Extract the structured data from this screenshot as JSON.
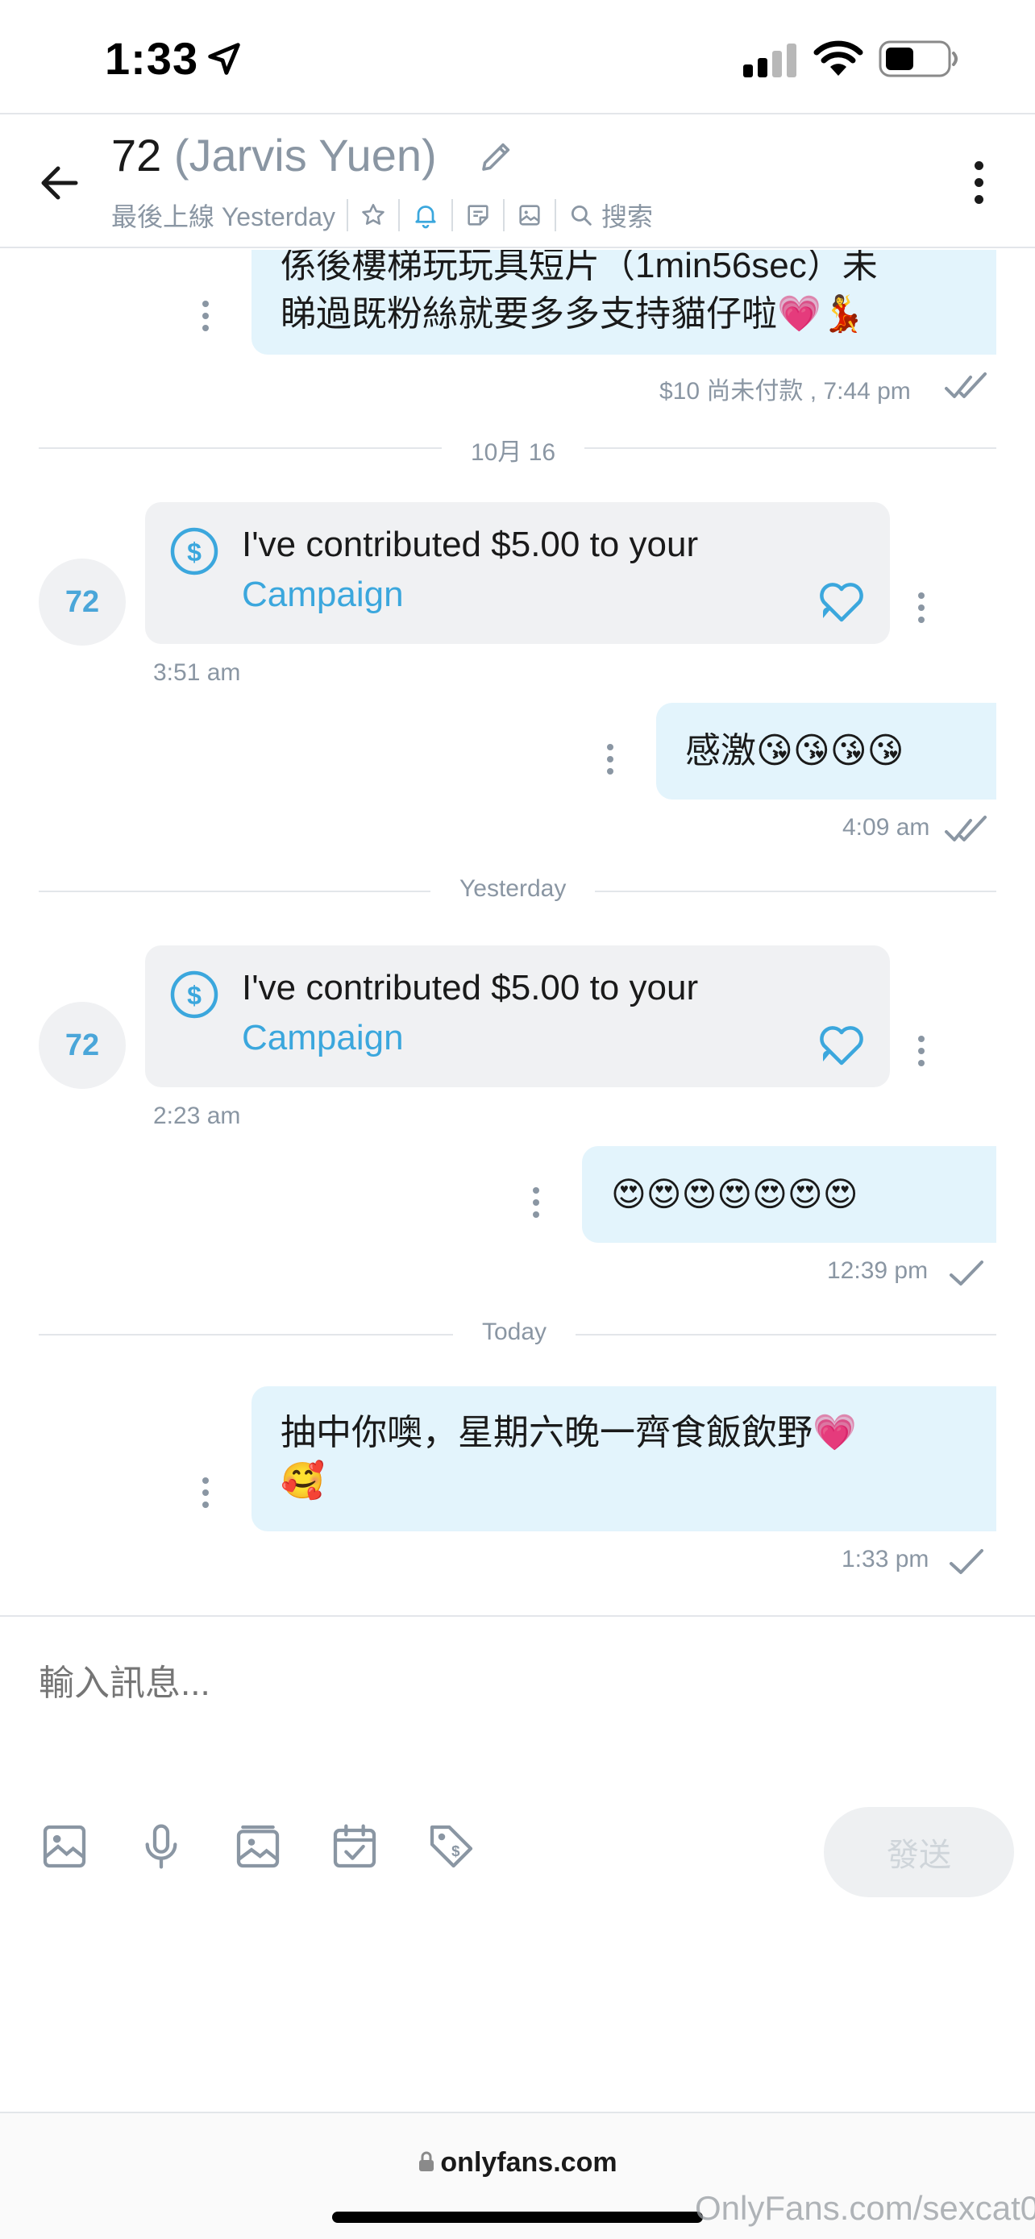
{
  "status_bar": {
    "time": "1:33",
    "icons": [
      "location-arrow-icon",
      "signal-icon",
      "wifi-icon",
      "battery-icon"
    ]
  },
  "header": {
    "title_name": "72",
    "title_username": "(Jarvis Yuen)",
    "last_seen": "最後上線 Yesterday",
    "search_label": "搜索",
    "icons": [
      "back-arrow-icon",
      "pencil-icon",
      "star-icon",
      "bell-icon",
      "note-icon",
      "image-icon",
      "search-icon",
      "kebab-icon"
    ]
  },
  "messages": {
    "m1": {
      "line1": "係後樓梯玩玩具短片（1min56sec）未",
      "line2": "睇過既粉絲就要多多支持貓仔啦💗💃",
      "meta": "$10 尚未付款 , 7:44 pm"
    },
    "divider1": "10月 16",
    "m2": {
      "avatar": "72",
      "text": "I've contributed $5.00 to your",
      "link": "Campaign",
      "time": "3:51 am"
    },
    "m3": {
      "text": "感激😘😘😘😘",
      "time": "4:09 am"
    },
    "divider2": "Yesterday",
    "m4": {
      "avatar": "72",
      "text": "I've contributed $5.00 to your",
      "link": "Campaign",
      "time": "2:23 am"
    },
    "m5": {
      "text": "😍😍😍😍😍😍😍",
      "time": "12:39 pm"
    },
    "divider3": "Today",
    "m6": {
      "line1": "抽中你噢，星期六晚一齊食飯飲野💗",
      "line2": "🥰",
      "time": "1:33 pm"
    }
  },
  "composer": {
    "placeholder": "輸入訊息...",
    "send_label": "發送",
    "tools": [
      "image-icon",
      "microphone-icon",
      "vault-icon",
      "schedule-icon",
      "price-tag-icon"
    ]
  },
  "browser": {
    "url": "onlyfans.com"
  },
  "watermark": "OnlyFans.com/sexcat07",
  "colors": {
    "accent": "#3ba7dd",
    "outgoing_bubble": "#e3f4fc",
    "incoming_bubble": "#f0f1f3",
    "muted": "#8a96a3"
  }
}
